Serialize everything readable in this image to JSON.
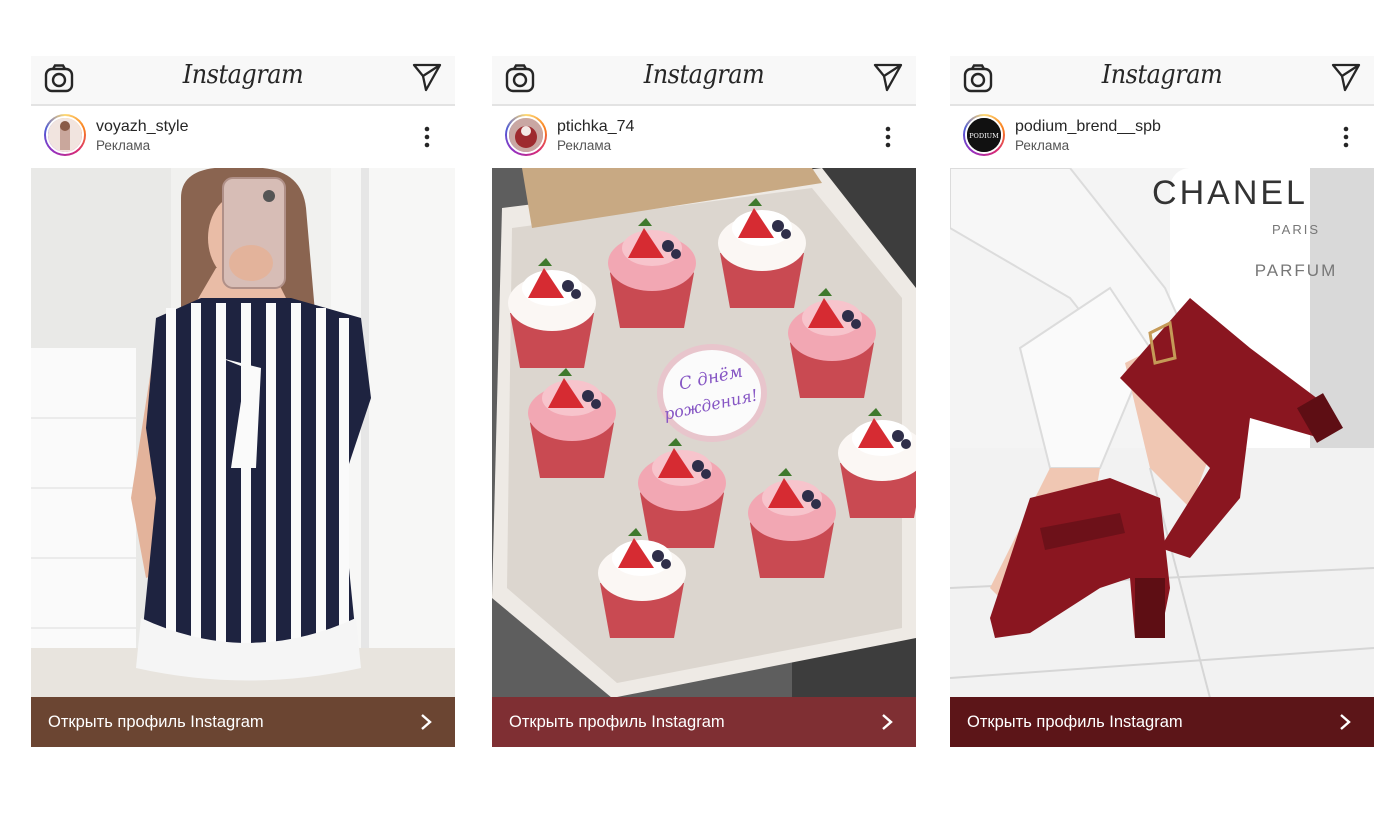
{
  "posts": [
    {
      "app_title": "Instagram",
      "username": "voyazh_style",
      "sponsored_label": "Реклама",
      "cta_label": "Открыть профиль Instagram",
      "cta_color": "#6b4532",
      "avatar_bg": "#e9d7d0",
      "image": "woman-in-striped-dress"
    },
    {
      "app_title": "Instagram",
      "username": "ptichka_74",
      "sponsored_label": "Реклама",
      "cta_label": "Открыть профиль Instagram",
      "cta_color": "#7f2f33",
      "avatar_bg": "#9e2a2f",
      "image": "box-of-strawberry-cupcakes",
      "image_text": "С днём рождения!"
    },
    {
      "app_title": "Instagram",
      "username": "podium_brend__spb",
      "sponsored_label": "Реклама",
      "cta_label": "Открыть профиль Instagram",
      "cta_color": "#5c1518",
      "avatar_bg": "#111111",
      "avatar_text": "PODIUM",
      "image": "burgundy-heeled-sandals",
      "image_text_brand": "CHANEL",
      "image_text_city": "PARIS",
      "image_text_product": "PARFUM"
    }
  ],
  "icons": {
    "camera": "camera-icon",
    "send": "send-icon",
    "more": "more-options-icon",
    "chevron": "chevron-right-icon"
  }
}
